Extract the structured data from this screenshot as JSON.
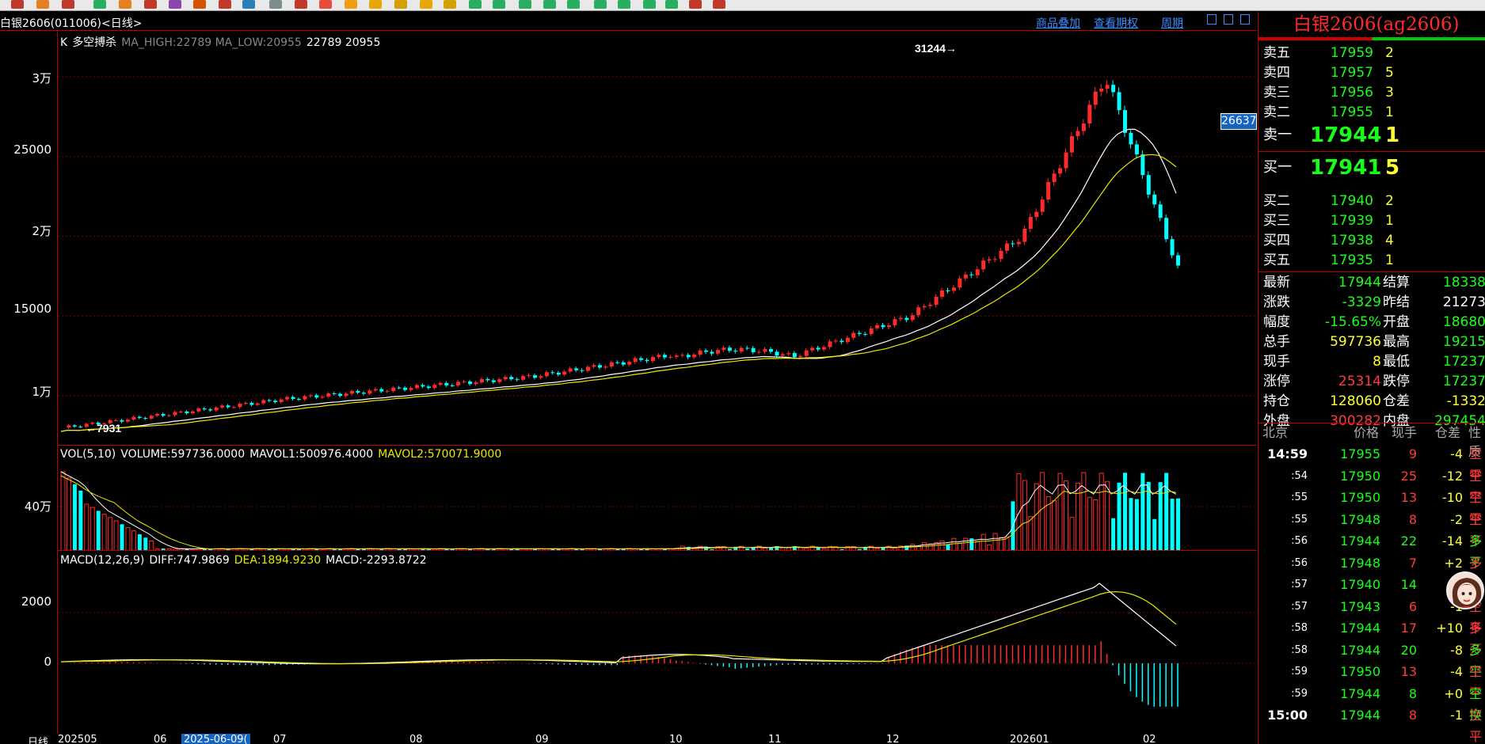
{
  "app": {
    "instrument": "白银2606(011006)<日线>",
    "menu_links": [
      "商品叠加",
      "查看期权",
      "周期"
    ]
  },
  "toolbar": {
    "buttons": [
      "tool-icon",
      "tool-icon",
      "tool-icon",
      "tool-icon",
      "tool-icon",
      "tool-icon",
      "tool-icon",
      "tool-icon",
      "tool-icon",
      "tool-icon",
      "tool-icon",
      "tool-icon",
      "tool-icon",
      "tool-icon",
      "tool-icon",
      "tool-icon",
      "tool-icon",
      "tool-icon",
      "tool-icon",
      "tool-icon",
      "tool-icon",
      "tool-icon",
      "tool-icon",
      "tool-icon",
      "tool-icon",
      "tool-icon",
      "tool-icon",
      "tool-icon",
      "tool-icon"
    ]
  },
  "kline": {
    "indicator_label": "K",
    "indicator_name": "多空搏杀",
    "ma_text": "MA_HIGH:22789 MA_LOW:20955",
    "ma_values": "22789 20955",
    "y_labels": [
      "3万",
      "25000",
      "2万",
      "15000",
      "1万"
    ],
    "high_marker": "31244",
    "low_marker": "7931",
    "price_tag": "26637"
  },
  "volume": {
    "title": "VOL(5,10)",
    "volume": "VOLUME:597736.0000",
    "mavol1": "MAVOL1:500976.4000",
    "mavol2": "MAVOL2:570071.9000",
    "y_label": "40万"
  },
  "macd": {
    "title": "MACD(12,26,9)",
    "diff": "DIFF:747.9869",
    "dea": "DEA:1894.9230",
    "macd": "MACD:-2293.8722",
    "y_labels": [
      "2000",
      "0"
    ]
  },
  "time_axis": {
    "label": "日线",
    "ticks": [
      "202505",
      "06",
      "2025-06-09(",
      "07",
      "08",
      "09",
      "10",
      "11",
      "12",
      "202601",
      "02"
    ]
  },
  "quote": {
    "title": "白银2606(ag2606)",
    "asks": [
      {
        "label": "卖五",
        "price": "17959",
        "qty": "2"
      },
      {
        "label": "卖四",
        "price": "17957",
        "qty": "5"
      },
      {
        "label": "卖三",
        "price": "17956",
        "qty": "3"
      },
      {
        "label": "卖二",
        "price": "17955",
        "qty": "1"
      },
      {
        "label": "卖一",
        "price": "17944",
        "qty": "1"
      }
    ],
    "bids": [
      {
        "label": "买一",
        "price": "17941",
        "qty": "5"
      },
      {
        "label": "买二",
        "price": "17940",
        "qty": "2"
      },
      {
        "label": "买三",
        "price": "17939",
        "qty": "1"
      },
      {
        "label": "买四",
        "price": "17938",
        "qty": "4"
      },
      {
        "label": "买五",
        "price": "17935",
        "qty": "1"
      }
    ],
    "stats": [
      {
        "l1": "最新",
        "v1": "17944",
        "c1": "#1aff1a",
        "l2": "结算",
        "v2": "18338",
        "c2": "#1aff1a"
      },
      {
        "l1": "涨跌",
        "v1": "-3329",
        "c1": "#1aff1a",
        "l2": "昨结",
        "v2": "21273",
        "c2": "#ffffff"
      },
      {
        "l1": "幅度",
        "v1": "-15.65%",
        "c1": "#1aff1a",
        "l2": "开盘",
        "v2": "18680",
        "c2": "#1aff1a"
      },
      {
        "l1": "总手",
        "v1": "597736",
        "c1": "#ffff33",
        "l2": "最高",
        "v2": "19215",
        "c2": "#1aff1a"
      },
      {
        "l1": "现手",
        "v1": "8",
        "c1": "#ffff33",
        "l2": "最低",
        "v2": "17237",
        "c2": "#1aff1a"
      },
      {
        "l1": "涨停",
        "v1": "25314",
        "c1": "#ff3b3b",
        "l2": "跌停",
        "v2": "17237",
        "c2": "#1aff1a"
      },
      {
        "l1": "持仓",
        "v1": "128060",
        "c1": "#ffff33",
        "l2": "仓差",
        "v2": "-1332",
        "c2": "#ffff33"
      },
      {
        "l1": "外盘",
        "v1": "300282",
        "c1": "#ff3b3b",
        "l2": "内盘",
        "v2": "297454",
        "c2": "#1aff1a"
      }
    ],
    "ticks_header": [
      "北京",
      "价格",
      "现手",
      "仓差",
      "性质"
    ],
    "ticks": [
      {
        "time": "14:59",
        "price": "17955",
        "vol": "9",
        "oi": "-4",
        "nature": "空平",
        "vc": "#ff3b3b",
        "oc": "#ffff33",
        "nc": "#ff3b3b"
      },
      {
        "time": ":54",
        "price": "17950",
        "vol": "25",
        "oi": "-12",
        "nature": "空平",
        "vc": "#ff3b3b",
        "oc": "#ffff33",
        "nc": "#ff3b3b"
      },
      {
        "time": ":55",
        "price": "17950",
        "vol": "13",
        "oi": "-10",
        "nature": "空平",
        "vc": "#ff3b3b",
        "oc": "#ffff33",
        "nc": "#ff3b3b"
      },
      {
        "time": ":55",
        "price": "17948",
        "vol": "8",
        "oi": "-2",
        "nature": "空平",
        "vc": "#ff3b3b",
        "oc": "#ffff33",
        "nc": "#ff3b3b"
      },
      {
        "time": ":56",
        "price": "17944",
        "vol": "22",
        "oi": "-14",
        "nature": "多平",
        "vc": "#1aff1a",
        "oc": "#ffff33",
        "nc": "#1aff1a"
      },
      {
        "time": ":56",
        "price": "17948",
        "vol": "7",
        "oi": "+2",
        "nature": "多开",
        "vc": "#ff3b3b",
        "oc": "#ffff33",
        "nc": "#ff3b3b"
      },
      {
        "time": ":57",
        "price": "17940",
        "vol": "14",
        "oi": "",
        "nature": "",
        "vc": "#1aff1a",
        "oc": "#ffff33",
        "nc": "#1aff1a"
      },
      {
        "time": ":57",
        "price": "17943",
        "vol": "6",
        "oi": "-1",
        "nature": "空平",
        "vc": "#ff3b3b",
        "oc": "#ffff33",
        "nc": "#ff3b3b"
      },
      {
        "time": ":58",
        "price": "17944",
        "vol": "17",
        "oi": "+10",
        "nature": "多开",
        "vc": "#ff3b3b",
        "oc": "#ffff33",
        "nc": "#ff3b3b"
      },
      {
        "time": ":58",
        "price": "17944",
        "vol": "20",
        "oi": "-8",
        "nature": "多平",
        "vc": "#1aff1a",
        "oc": "#ffff33",
        "nc": "#1aff1a"
      },
      {
        "time": ":59",
        "price": "17950",
        "vol": "13",
        "oi": "-4",
        "nature": "空平",
        "vc": "#ff3b3b",
        "oc": "#ffff33",
        "nc": "#ff3b3b"
      },
      {
        "time": ":59",
        "price": "17944",
        "vol": "8",
        "oi": "+0",
        "nature": "空换",
        "vc": "#1aff1a",
        "oc": "#ffff33",
        "nc": "#1aff1a"
      },
      {
        "time": "15:00",
        "price": "17944",
        "vol": "8",
        "oi": "-1",
        "nature": "空平",
        "vc": "#ff3b3b",
        "oc": "#ffff33",
        "nc": "#ff3b3b"
      }
    ]
  },
  "colors": {
    "up": "#ff2b2b",
    "down": "#00ffff",
    "grid": "#7a0000",
    "ma_white": "#ffffff",
    "ma_yellow": "#e8e800"
  }
}
